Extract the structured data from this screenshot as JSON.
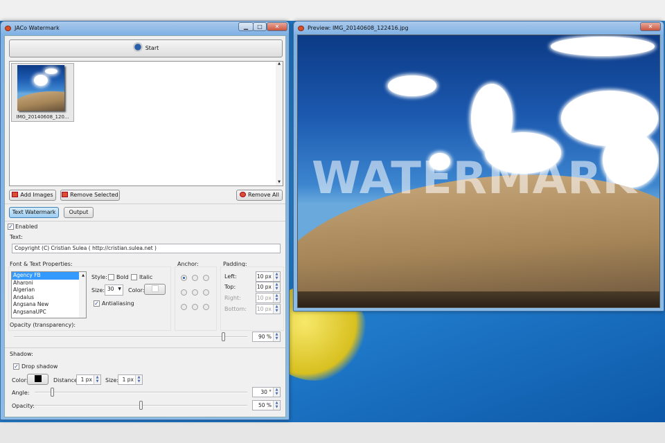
{
  "main_window": {
    "title": "JACo Watermark",
    "controls": {
      "minimize": "▁",
      "maximize": "□",
      "close": "✕"
    },
    "start_label": "Start",
    "thumbnails": [
      {
        "caption": "IMG_20140608_120..."
      }
    ],
    "add_images_label": "Add Images",
    "remove_selected_label": "Remove Selected",
    "remove_all_label": "Remove All",
    "tabs": [
      {
        "label": "Text Watermark",
        "active": true
      },
      {
        "label": "Output",
        "active": false
      }
    ],
    "enabled_label": "Enabled",
    "enabled": true,
    "text_label": "Text:",
    "text_value": "Copyright (C) Cristian Sulea ( http://cristian.sulea.net )",
    "font_group_label": "Font & Text Properties:",
    "fonts": [
      "Agency FB",
      "Aharoni",
      "Algerian",
      "Andalus",
      "Angsana New",
      "AngsanaUPC"
    ],
    "selected_font": "Agency FB",
    "style_label": "Style:",
    "bold_label": "Bold",
    "italic_label": "Italic",
    "bold": false,
    "italic": false,
    "size_label": "Size:",
    "size_value": "30",
    "color_label": "Color:",
    "text_color": "#ffffff",
    "antialiasing_label": "Antialiasing",
    "antialiasing": true,
    "anchor_label": "Anchor:",
    "anchor_selected": "top-left",
    "padding_label": "Padding:",
    "padding": [
      {
        "label": "Left:",
        "value": "10 px",
        "enabled": true
      },
      {
        "label": "Top:",
        "value": "10 px",
        "enabled": true
      },
      {
        "label": "Right:",
        "value": "10 px",
        "enabled": false
      },
      {
        "label": "Bottom:",
        "value": "10 px",
        "enabled": false
      }
    ],
    "opacity_label": "Opacity (transparency):",
    "opacity_value": "90 %",
    "opacity_percent": 90,
    "shadow_label": "Shadow:",
    "drop_shadow_label": "Drop shadow",
    "drop_shadow": true,
    "shadow_color_label": "Color:",
    "shadow_color": "#000000",
    "distance_label": "Distance:",
    "distance_value": "1 px",
    "size2_label": "Size:",
    "size2_value": "1 px",
    "angle_label": "Angle:",
    "angle_value": "30 °",
    "angle_degrees": 30,
    "shadow_opacity_label": "Opacity:",
    "shadow_opacity_value": "50 %",
    "shadow_opacity_percent": 50
  },
  "preview_window": {
    "title": "Preview: IMG_20140608_122416.jpg",
    "close": "✕",
    "watermark_text": "WATERMARK"
  }
}
